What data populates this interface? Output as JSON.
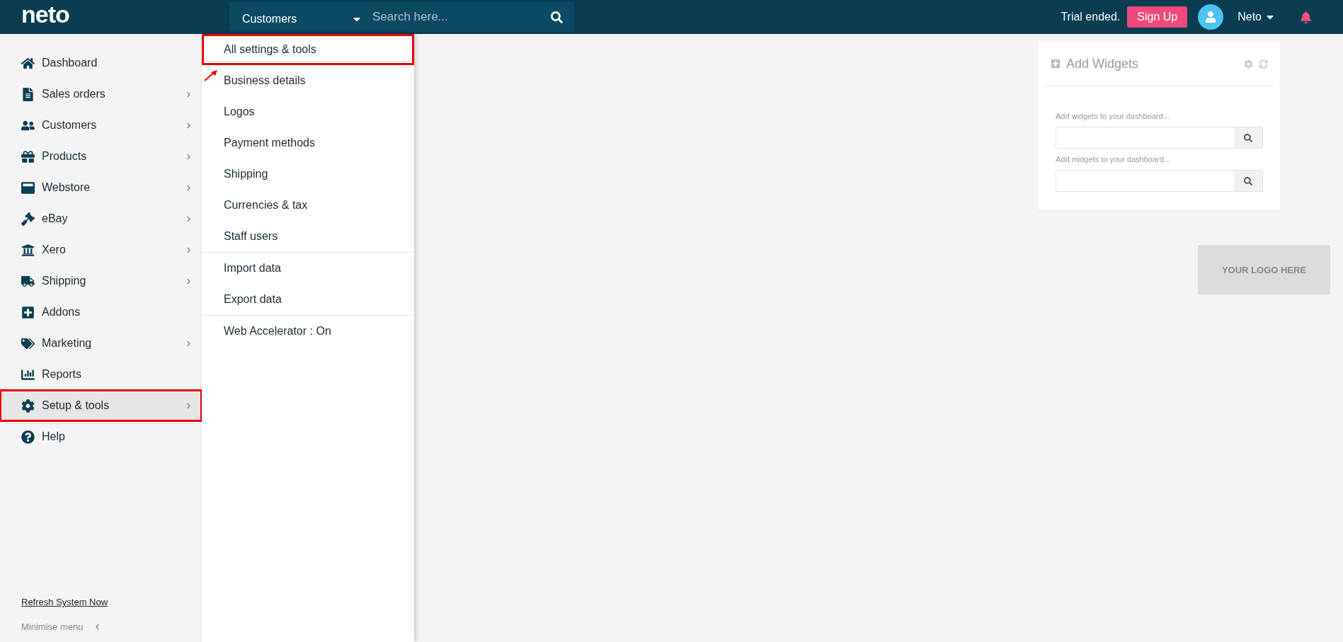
{
  "topbar": {
    "logo": "neto",
    "search_scope": "Customers",
    "search": {
      "placeholder": "Search here..."
    },
    "trial_notice": "Trial ended.",
    "signup_button": "Sign Up",
    "user_name": "Neto"
  },
  "sidebar": {
    "items": [
      {
        "label": "Dashboard",
        "has_submenu": false,
        "selected": false,
        "highlighted": false
      },
      {
        "label": "Sales orders",
        "has_submenu": true,
        "selected": false,
        "highlighted": false
      },
      {
        "label": "Customers",
        "has_submenu": true,
        "selected": false,
        "highlighted": false
      },
      {
        "label": "Products",
        "has_submenu": true,
        "selected": false,
        "highlighted": false
      },
      {
        "label": "Webstore",
        "has_submenu": true,
        "selected": false,
        "highlighted": false
      },
      {
        "label": "eBay",
        "has_submenu": true,
        "selected": false,
        "highlighted": false
      },
      {
        "label": "Xero",
        "has_submenu": true,
        "selected": false,
        "highlighted": false
      },
      {
        "label": "Shipping",
        "has_submenu": true,
        "selected": false,
        "highlighted": false
      },
      {
        "label": "Addons",
        "has_submenu": false,
        "selected": false,
        "highlighted": false
      },
      {
        "label": "Marketing",
        "has_submenu": true,
        "selected": false,
        "highlighted": false
      },
      {
        "label": "Reports",
        "has_submenu": false,
        "selected": false,
        "highlighted": false
      },
      {
        "label": "Setup & tools",
        "has_submenu": true,
        "selected": true,
        "highlighted": true
      },
      {
        "label": "Help",
        "has_submenu": false,
        "selected": false,
        "highlighted": false
      }
    ],
    "refresh_link": "Refresh System Now",
    "minimise": "Minimise menu"
  },
  "dropdown": {
    "groups": [
      {
        "items": [
          {
            "label": "All settings & tools",
            "highlighted": true
          },
          {
            "label": "Business details",
            "highlighted": false
          },
          {
            "label": "Logos",
            "highlighted": false
          },
          {
            "label": "Payment methods",
            "highlighted": false
          },
          {
            "label": "Shipping",
            "highlighted": false
          },
          {
            "label": "Currencies & tax",
            "highlighted": false
          },
          {
            "label": "Staff users",
            "highlighted": false
          }
        ]
      },
      {
        "items": [
          {
            "label": "Import data",
            "highlighted": false
          },
          {
            "label": "Export data",
            "highlighted": false
          }
        ]
      },
      {
        "items": [
          {
            "label": "Web Accelerator : On",
            "highlighted": false
          }
        ]
      }
    ]
  },
  "widget_panel": {
    "title": "Add Widgets",
    "fields": [
      {
        "label": "Add widgets to your dashboard..."
      },
      {
        "label": "Add midgets to your dashboard..."
      }
    ]
  },
  "logo_placeholder": "YOUR LOGO HERE"
}
